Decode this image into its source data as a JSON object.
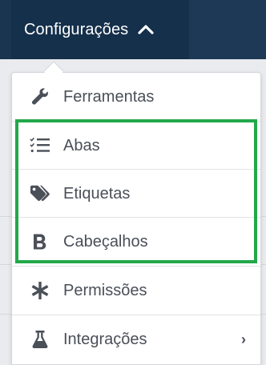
{
  "header": {
    "menu_button_label": "Configurações",
    "menu_button_icon": "chevron-up-icon"
  },
  "menu": {
    "items": [
      {
        "label": "Ferramentas",
        "icon": "wrench-icon"
      },
      {
        "label": "Abas",
        "icon": "checklist-icon"
      },
      {
        "label": "Etiquetas",
        "icon": "tags-icon"
      },
      {
        "label": "Cabeçalhos",
        "icon": "bold-b-icon"
      },
      {
        "label": "Permissões",
        "icon": "asterisk-icon"
      },
      {
        "label": "Integrações",
        "icon": "flask-icon",
        "submenu_indicator": "›"
      }
    ],
    "highlight_color": "#22a84a"
  },
  "colors": {
    "navbar": "#1a3550",
    "menu_text": "#4a4f58"
  }
}
